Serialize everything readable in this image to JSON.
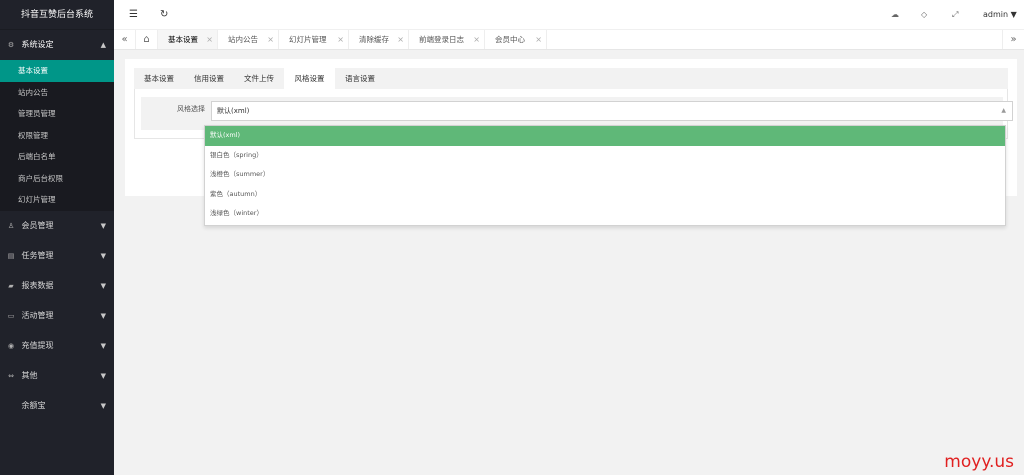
{
  "app_title": "抖音互赞后台系统",
  "sidebar": {
    "groups": [
      {
        "label": "系统设定",
        "icon": "gear-icon",
        "icon_char": "⚙",
        "arrow": "▲"
      },
      {
        "label": "会员管理",
        "icon": "user-icon",
        "icon_char": "♙",
        "arrow": "▼"
      },
      {
        "label": "任务管理",
        "icon": "task-icon",
        "icon_char": "▤",
        "arrow": "▼"
      },
      {
        "label": "报表数据",
        "icon": "report-icon",
        "icon_char": "▰",
        "arrow": "▼"
      },
      {
        "label": "活动管理",
        "icon": "activity-icon",
        "icon_char": "▭",
        "arrow": "▼"
      },
      {
        "label": "充值提现",
        "icon": "money-icon",
        "icon_char": "◉",
        "arrow": "▼"
      },
      {
        "label": "其他",
        "icon": "link-icon",
        "icon_char": "⇔",
        "arrow": "▼"
      },
      {
        "label": "余额宝",
        "icon": "",
        "icon_char": "",
        "arrow": "▼"
      }
    ],
    "sub_items": [
      "基本设置",
      "站内公告",
      "管理员管理",
      "权限管理",
      "后端白名单",
      "商户后台权限",
      "幻灯片管理"
    ]
  },
  "topbar": {
    "menu_icon": "☰",
    "refresh_icon": "↻",
    "theme_icon": "☁",
    "tag_icon": "◇",
    "fullscreen_icon": "⤢",
    "user": "admin ▼"
  },
  "tabs": {
    "prev": "«",
    "next": "»",
    "home_icon": "⌂",
    "close": "×",
    "items": [
      "基本设置",
      "站内公告",
      "幻灯片管理",
      "清除缓存",
      "前端登录日志",
      "会员中心"
    ]
  },
  "settings": {
    "tabs": [
      "基本设置",
      "信用设置",
      "文件上传",
      "风格设置",
      "语言设置"
    ],
    "field_label": "风格选择",
    "selected_value": "默认(xml)",
    "caret": "▲",
    "options": [
      "默认(xml)",
      "银白色（spring）",
      "浅橙色（summer）",
      "紫色（autumn）",
      "浅绿色（winter）"
    ]
  },
  "watermark": "moyy.us",
  "colors": {
    "sidebar_bg": "#20222a",
    "active_teal": "#009688",
    "selected_green": "#5fb878"
  }
}
